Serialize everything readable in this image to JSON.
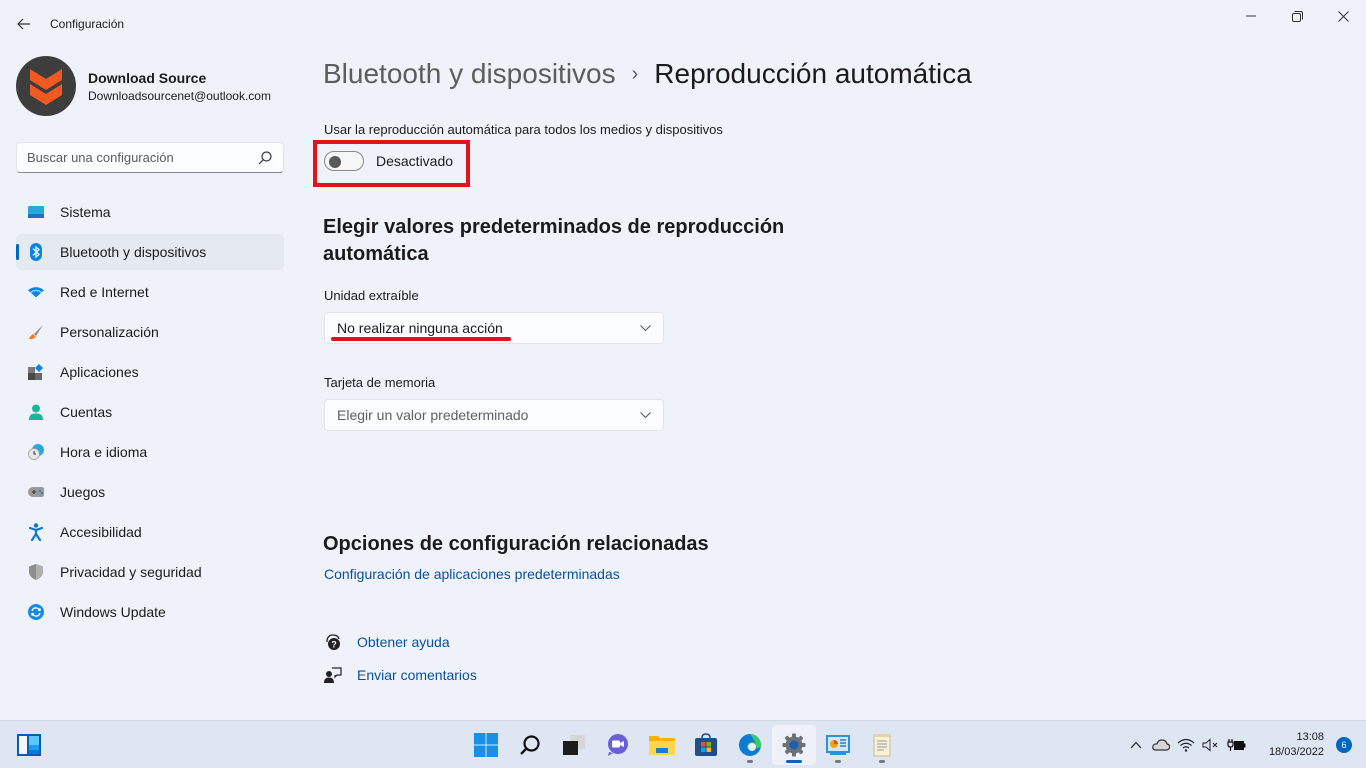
{
  "window": {
    "app_title": "Configuración",
    "controls": {
      "minimize": "minimize-icon",
      "maximize": "restore-icon",
      "close": "close-icon"
    }
  },
  "profile": {
    "name": "Download Source",
    "email": "Downloadsourcenet@outlook.com"
  },
  "search": {
    "placeholder": "Buscar una configuración",
    "value": ""
  },
  "sidebar": {
    "items": [
      {
        "label": "Sistema",
        "icon": "system-icon",
        "active": false
      },
      {
        "label": "Bluetooth y dispositivos",
        "icon": "bluetooth-icon",
        "active": true
      },
      {
        "label": "Red e Internet",
        "icon": "wifi-icon",
        "active": false
      },
      {
        "label": "Personalización",
        "icon": "brush-icon",
        "active": false
      },
      {
        "label": "Aplicaciones",
        "icon": "apps-icon",
        "active": false
      },
      {
        "label": "Cuentas",
        "icon": "account-icon",
        "active": false
      },
      {
        "label": "Hora e idioma",
        "icon": "time-language-icon",
        "active": false
      },
      {
        "label": "Juegos",
        "icon": "gamepad-icon",
        "active": false
      },
      {
        "label": "Accesibilidad",
        "icon": "accessibility-icon",
        "active": false
      },
      {
        "label": "Privacidad y seguridad",
        "icon": "shield-icon",
        "active": false
      },
      {
        "label": "Windows Update",
        "icon": "update-icon",
        "active": false
      }
    ]
  },
  "main": {
    "breadcrumb": {
      "parent": "Bluetooth y dispositivos",
      "separator": "›",
      "current": "Reproducción automática"
    },
    "autoplay": {
      "label": "Usar la reproducción automática para todos los medios y dispositivos",
      "toggle_on": false,
      "toggle_text": "Desactivado"
    },
    "defaults_section": {
      "title": "Elegir valores predeterminados de reproducción automática",
      "removable_drive": {
        "label": "Unidad extraíble",
        "value": "No realizar ninguna acción"
      },
      "memory_card": {
        "label": "Tarjeta de memoria",
        "value": "",
        "placeholder": "Elegir un valor predeterminado"
      }
    },
    "related": {
      "title": "Opciones de configuración relacionadas",
      "link": "Configuración de aplicaciones predeterminadas"
    },
    "help": {
      "get_help": "Obtener ayuda",
      "feedback": "Enviar comentarios"
    }
  },
  "annotations": {
    "highlight_color": "#e0121e"
  },
  "taskbar": {
    "apps": [
      {
        "name": "start",
        "active": false,
        "running": false
      },
      {
        "name": "search",
        "active": false,
        "running": false
      },
      {
        "name": "task-view",
        "active": false,
        "running": false
      },
      {
        "name": "chat",
        "active": false,
        "running": false
      },
      {
        "name": "file-explorer",
        "active": false,
        "running": false
      },
      {
        "name": "store",
        "active": false,
        "running": false
      },
      {
        "name": "edge",
        "active": false,
        "running": true
      },
      {
        "name": "settings",
        "active": true,
        "running": true
      },
      {
        "name": "control-panel",
        "active": false,
        "running": true
      },
      {
        "name": "notepad",
        "active": false,
        "running": true
      }
    ],
    "clock": {
      "time": "13:08",
      "date": "18/03/2022"
    },
    "notification_count": "6"
  },
  "colors": {
    "accent": "#0067c0",
    "link": "#0a4f9a",
    "background": "#eff3f9"
  }
}
